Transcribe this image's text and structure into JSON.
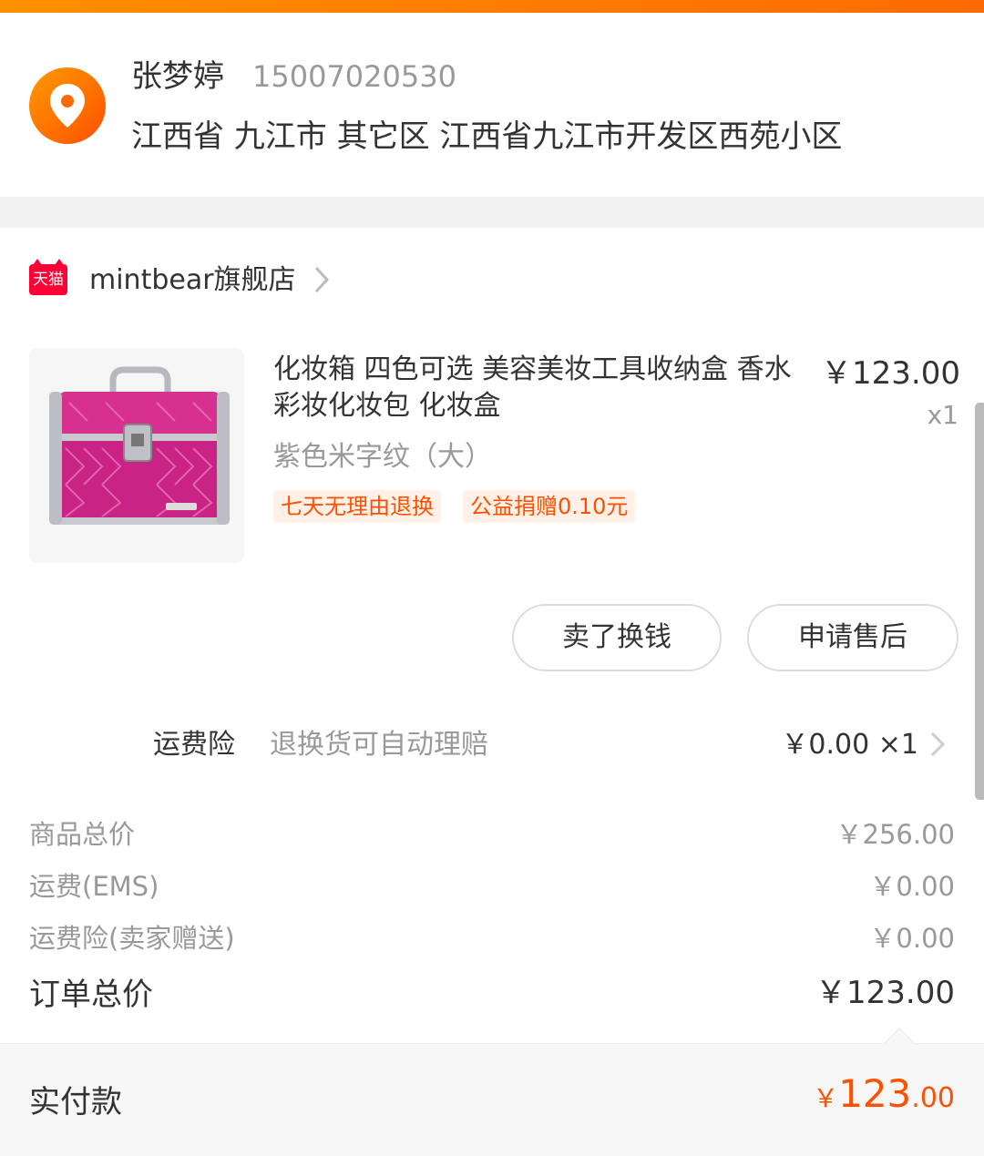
{
  "address": {
    "name": "张梦婷",
    "phone": "15007020530",
    "full_address": "江西省 九江市 其它区 江西省九江市开发区西苑小区"
  },
  "shop": {
    "badge": "天猫",
    "name": "mintbear旗舰店"
  },
  "product": {
    "title": "化妆箱 四色可选 美容美妆工具收纳盒 香水彩妆化妆包 化妆盒",
    "price": "￥123.00",
    "quantity": "x1",
    "sku": "紫色米字纹（大）",
    "tags": [
      "七天无理由退换",
      "公益捐赠0.10元"
    ],
    "image_icon": "cosmetic-case-image"
  },
  "actions": {
    "sell_label": "卖了换钱",
    "after_sale_label": "申请售后"
  },
  "insurance": {
    "label": "运费险",
    "desc": "退换货可自动理赔",
    "value": "￥0.00 ×1"
  },
  "summary": {
    "rows": [
      {
        "label": "商品总价",
        "value": "￥256.00"
      },
      {
        "label": "运费(EMS)",
        "value": "￥0.00"
      },
      {
        "label": "运费险(卖家赠送)",
        "value": "￥0.00"
      }
    ],
    "order_total_label": "订单总价",
    "order_total_value": "￥123.00"
  },
  "paid": {
    "label": "实付款",
    "symbol": "￥",
    "integer": "123",
    "decimal": ".00"
  },
  "colors": {
    "accent": "#ff5000",
    "top_bar": "#ff7a00",
    "tmall_red": "#ff0036"
  }
}
